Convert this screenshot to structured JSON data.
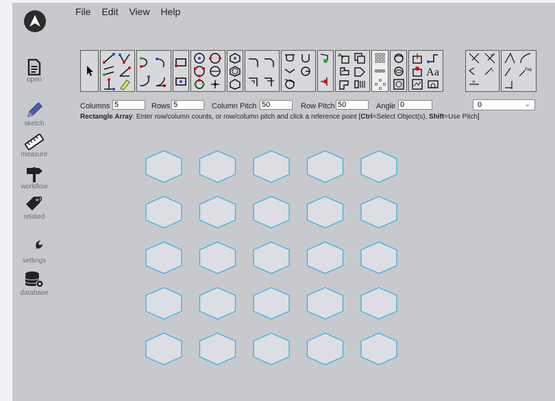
{
  "menu": {
    "file": "File",
    "edit": "Edit",
    "view": "View",
    "help": "Help"
  },
  "sidebar": {
    "items": [
      {
        "label": "open",
        "icon": "document-icon"
      },
      {
        "label": "sketch",
        "icon": "pencil-icon"
      },
      {
        "label": "measure",
        "icon": "ruler-icon"
      },
      {
        "label": "workflow",
        "icon": "signpost-icon"
      },
      {
        "label": "related",
        "icon": "tag-icon"
      },
      {
        "label": "settings",
        "icon": "wrench-icon"
      },
      {
        "label": "database",
        "icon": "database-gear-icon"
      }
    ]
  },
  "params": {
    "columns_label": "Columns",
    "columns_value": "5",
    "rows_label": "Rows",
    "rows_value": "5",
    "col_pitch_label": "Column Pitch",
    "col_pitch_value": "50",
    "row_pitch_label": "Row Pitch",
    "row_pitch_value": "50",
    "angle_label": "Angle",
    "angle_value": "0",
    "layer_value": "0"
  },
  "instruction": {
    "title": "Rectangle Array",
    "text_a": ": Enter row/column counts, or row/column pitch and click a reference point [",
    "ctrl": "Ctrl",
    "text_b": "=Select Object(s), ",
    "shift": "Shift",
    "text_c": "=Use Pitch]"
  },
  "colors": {
    "accent": "#2a9fd6",
    "hex_fill": "#dddee3",
    "hex_stroke": "#33b3e8",
    "background": "#c8c9cd"
  },
  "array": {
    "columns": 5,
    "rows": 5,
    "shape": "hexagon"
  }
}
